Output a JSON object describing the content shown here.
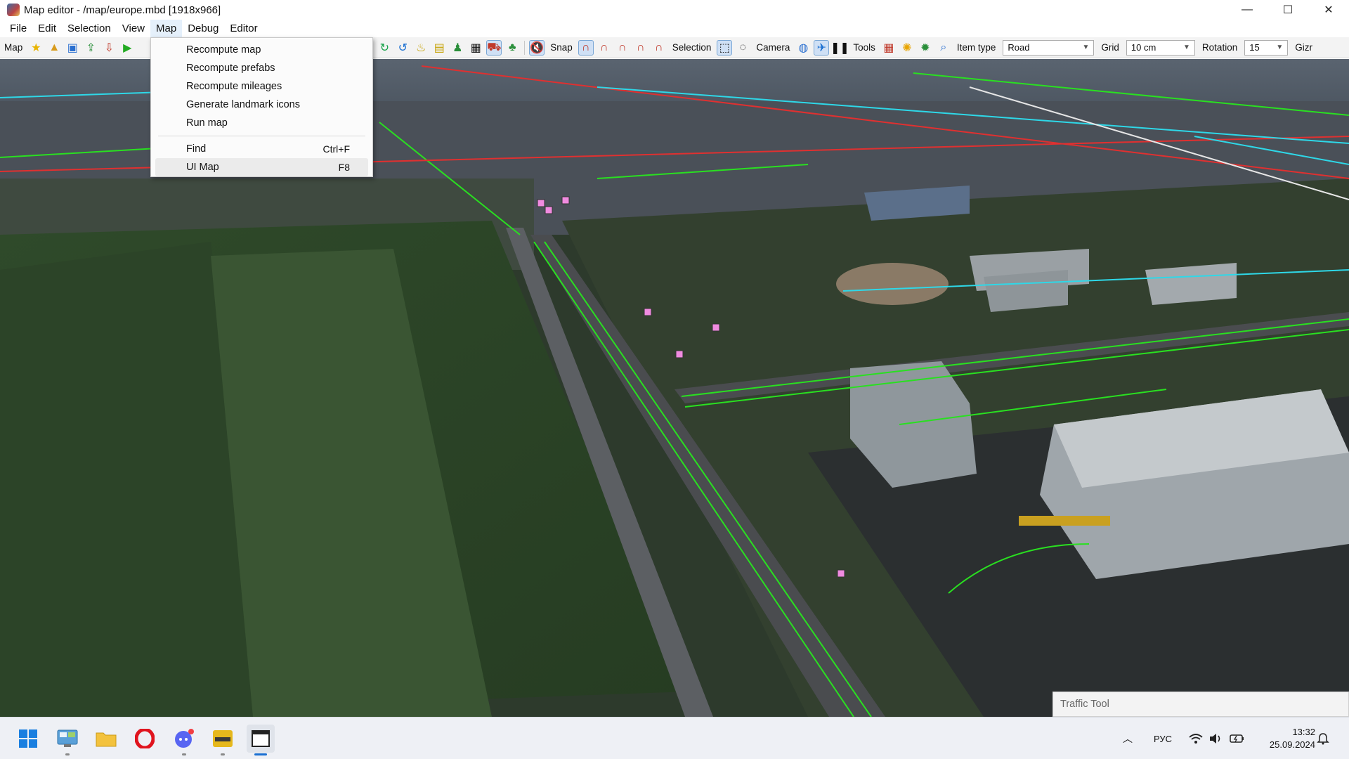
{
  "window": {
    "title": "Map editor - /map/europe.mbd [1918x966]",
    "controls": {
      "minimize": "—",
      "maximize": "☐",
      "close": "✕"
    }
  },
  "menubar": {
    "items": [
      "File",
      "Edit",
      "Selection",
      "View",
      "Map",
      "Debug",
      "Editor"
    ],
    "active": "Map"
  },
  "toolbar": {
    "map_label": "Map",
    "snap_label": "Snap",
    "selection_label": "Selection",
    "camera_label": "Camera",
    "tools_label": "Tools",
    "item_type_label": "Item type",
    "item_type_value": "Road",
    "grid_label": "Grid",
    "grid_value": "10 cm",
    "rotation_label": "Rotation",
    "rotation_value": "15",
    "gizmo_label": "Gizr"
  },
  "map_menu": {
    "items": [
      {
        "label": "Recompute map",
        "shortcut": ""
      },
      {
        "label": "Recompute prefabs",
        "shortcut": ""
      },
      {
        "label": "Recompute mileages",
        "shortcut": ""
      },
      {
        "label": "Generate landmark icons",
        "shortcut": ""
      },
      {
        "label": "Run map",
        "shortcut": ""
      },
      {
        "label": "Find",
        "shortcut": "Ctrl+F"
      },
      {
        "label": "UI Map",
        "shortcut": "F8"
      }
    ],
    "highlighted": "UI Map"
  },
  "traffic_panel": {
    "label": "Traffic Tool"
  },
  "taskbar": {
    "apps": [
      "start-icon",
      "control-panel-icon",
      "file-explorer-icon",
      "opera-browser-icon",
      "discord-icon",
      "ets2-game-icon",
      "map-editor-window-icon"
    ],
    "language": "РУС",
    "time": "13:32",
    "date": "25.09.2024"
  },
  "colors": {
    "road_guide": "#29e020",
    "boundary_red": "#e03030",
    "boundary_cyan": "#2ed8e8",
    "node_marker": "#f08be0",
    "accent": "#1a6fd1"
  }
}
